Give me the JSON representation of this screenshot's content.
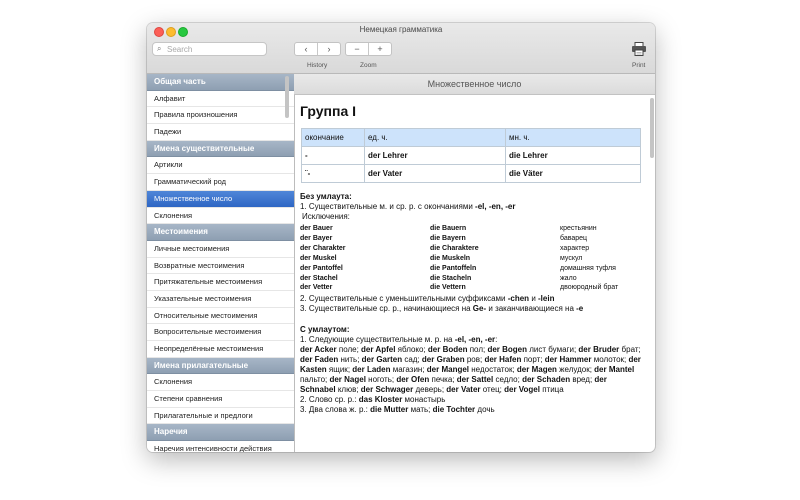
{
  "window": {
    "title": "Немецкая грамматика"
  },
  "toolbar": {
    "search_placeholder": "Search",
    "history_label": "History",
    "zoom_label": "Zoom",
    "print_label": "Print",
    "back_glyph": "‹",
    "forward_glyph": "›",
    "zoom_out_glyph": "−",
    "zoom_in_glyph": "+"
  },
  "sidebar": {
    "items": [
      {
        "label": "Общая часть",
        "type": "header"
      },
      {
        "label": "Алфавит",
        "type": "item"
      },
      {
        "label": "Правила произношения",
        "type": "item"
      },
      {
        "label": "Падежи",
        "type": "item"
      },
      {
        "label": "Имена существительные",
        "type": "header"
      },
      {
        "label": "Артикли",
        "type": "item"
      },
      {
        "label": "Грамматический род",
        "type": "item"
      },
      {
        "label": "Множественное число",
        "type": "item",
        "selected": true
      },
      {
        "label": "Склонения",
        "type": "item"
      },
      {
        "label": "Местоимения",
        "type": "header"
      },
      {
        "label": "Личные местоимения",
        "type": "item"
      },
      {
        "label": "Возвратные местоимения",
        "type": "item"
      },
      {
        "label": "Притяжательные местоимения",
        "type": "item"
      },
      {
        "label": "Указательные местоимения",
        "type": "item"
      },
      {
        "label": "Относительные местоимения",
        "type": "item"
      },
      {
        "label": "Вопросительные местоимения",
        "type": "item"
      },
      {
        "label": "Неопределённые местоимения",
        "type": "item"
      },
      {
        "label": "Имена прилагательные",
        "type": "header"
      },
      {
        "label": "Склонения",
        "type": "item"
      },
      {
        "label": "Степени сравнения",
        "type": "item"
      },
      {
        "label": "Прилагательные и предлоги",
        "type": "item"
      },
      {
        "label": "Наречия",
        "type": "header"
      },
      {
        "label": "Наречия интенсивности действия",
        "type": "item"
      }
    ]
  },
  "content": {
    "header": "Множественное число",
    "heading": "Группа I",
    "table": {
      "columns": [
        "окончание",
        "ед. ч.",
        "мн. ч."
      ],
      "rows": [
        [
          "-",
          "der Lehrer",
          "die Lehrer"
        ],
        [
          "¨-",
          "der Vater",
          "die Väter"
        ]
      ]
    },
    "without_umlaut": {
      "title": "Без умлаута:",
      "line1_prefix": "1. Существительные м. и ср. р. с окончаниями",
      "line1_endings": "-el, -en, -er",
      "exceptions_label": "Исключения:",
      "words": [
        [
          "der Bauer",
          "die Bauern",
          "крестьянин"
        ],
        [
          "der Bayer",
          "die Bayern",
          "баварец"
        ],
        [
          "der Charakter",
          "die Charaktere",
          "характер"
        ],
        [
          "der Muskel",
          "die Muskeln",
          "мускул"
        ],
        [
          "der Pantoffel",
          "die Pantoffeln",
          "домашняя туфля"
        ],
        [
          "der Stachel",
          "die Stacheln",
          "жало"
        ],
        [
          "der Vetter",
          "die Vettern",
          "двоюродный брат"
        ]
      ],
      "line2_prefix": "2. Существительные с уменьшительными суффиксами",
      "line2_suffix1": "-chen",
      "line2_and": "и",
      "line2_suffix2": "-lein",
      "line3_prefix": "3. Существительные ср. р., начинающиеся на",
      "line3_ge": "Ge-",
      "line3_mid": "и заканчивающиеся на",
      "line3_e": "-e"
    },
    "with_umlaut": {
      "title": "С умлаутом:",
      "line1_prefix": "1. Следующие существительные м. р. на",
      "line1_endings": "-el, -en, -er",
      "line1_colon": ":",
      "examples": [
        [
          "der Acker",
          "поле"
        ],
        [
          "der Apfel",
          "яблоко"
        ],
        [
          "der Boden",
          "пол"
        ],
        [
          "der Bogen",
          "лист бумаги"
        ],
        [
          "der Bruder",
          "брат"
        ],
        [
          "der Faden",
          "нить"
        ],
        [
          "der Garten",
          "сад"
        ],
        [
          "der Graben",
          "ров"
        ],
        [
          "der Hafen",
          "порт"
        ],
        [
          "der Hammer",
          "молоток"
        ],
        [
          "der Kasten",
          "ящик"
        ],
        [
          "der Laden",
          "магазин"
        ],
        [
          "der Mangel",
          "недостаток"
        ],
        [
          "der Magen",
          "желудок"
        ],
        [
          "der Mantel",
          "пальто"
        ],
        [
          "der Nagel",
          "ноготь"
        ],
        [
          "der Ofen",
          "печка"
        ],
        [
          "der Sattel",
          "седло"
        ],
        [
          "der Schaden",
          "вред"
        ],
        [
          "der Schnabel",
          "клюв"
        ],
        [
          "der Schwager",
          "деверь"
        ],
        [
          "der Vater",
          "отец"
        ],
        [
          "der Vogel",
          "птица"
        ]
      ],
      "line2_prefix": "2. Слово ср. р.:",
      "line2_word": "das Kloster",
      "line2_tr": "монастырь",
      "line3_prefix": "3. Два слова ж. р.:",
      "line3_word1": "die Mutter",
      "line3_tr1": "мать;",
      "line3_word2": "die Tochter",
      "line3_tr2": "дочь"
    }
  }
}
